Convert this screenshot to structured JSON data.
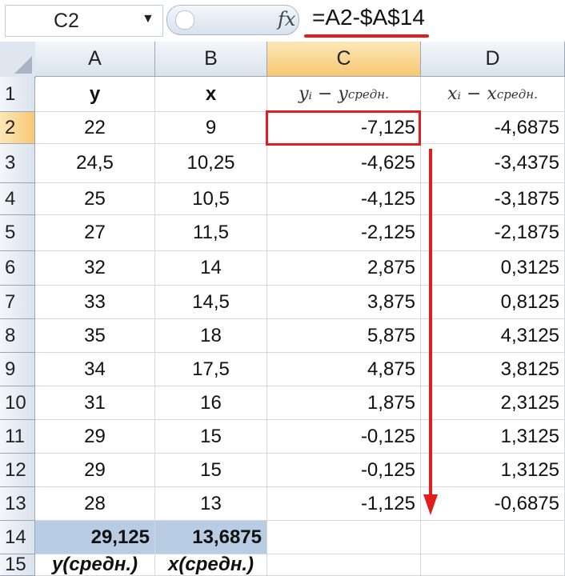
{
  "formula_bar": {
    "name_box": "C2",
    "fx_label": "fx",
    "formula": "=A2-$A$14"
  },
  "columns": [
    "A",
    "B",
    "C",
    "D"
  ],
  "rows": [
    "1",
    "2",
    "3",
    "4",
    "5",
    "6",
    "7",
    "8",
    "9",
    "10",
    "11",
    "12",
    "13",
    "14",
    "15"
  ],
  "selected_cell": "C2",
  "header_row": {
    "a": "y",
    "b": "x",
    "c": {
      "base": "yᵢ − y",
      "sub": "средн."
    },
    "d": {
      "base": "xᵢ − x",
      "sub": "средн."
    }
  },
  "data_rows": [
    {
      "a": "22",
      "b": "9",
      "c": "-7,125",
      "d": "-4,6875"
    },
    {
      "a": "24,5",
      "b": "10,25",
      "c": "-4,625",
      "d": "-3,4375"
    },
    {
      "a": "25",
      "b": "10,5",
      "c": "-4,125",
      "d": "-3,1875"
    },
    {
      "a": "27",
      "b": "11,5",
      "c": "-2,125",
      "d": "-2,1875"
    },
    {
      "a": "32",
      "b": "14",
      "c": "2,875",
      "d": "0,3125"
    },
    {
      "a": "33",
      "b": "14,5",
      "c": "3,875",
      "d": "0,8125"
    },
    {
      "a": "35",
      "b": "18",
      "c": "5,875",
      "d": "4,3125"
    },
    {
      "a": "34",
      "b": "17,5",
      "c": "4,875",
      "d": "3,8125"
    },
    {
      "a": "31",
      "b": "16",
      "c": "1,875",
      "d": "2,3125"
    },
    {
      "a": "29",
      "b": "15",
      "c": "-0,125",
      "d": "1,3125"
    },
    {
      "a": "29",
      "b": "15",
      "c": "-0,125",
      "d": "1,3125"
    },
    {
      "a": "28",
      "b": "13",
      "c": "-1,125",
      "d": "-0,6875"
    }
  ],
  "summary_row": {
    "a": "29,125",
    "b": "13,6875"
  },
  "label_row": {
    "a": "y(средн.)",
    "b": "x(средн.)"
  },
  "colors": {
    "accent_red": "#e21d1d",
    "summary_fill": "#b8cce4",
    "selected_header": "#f7c872"
  }
}
